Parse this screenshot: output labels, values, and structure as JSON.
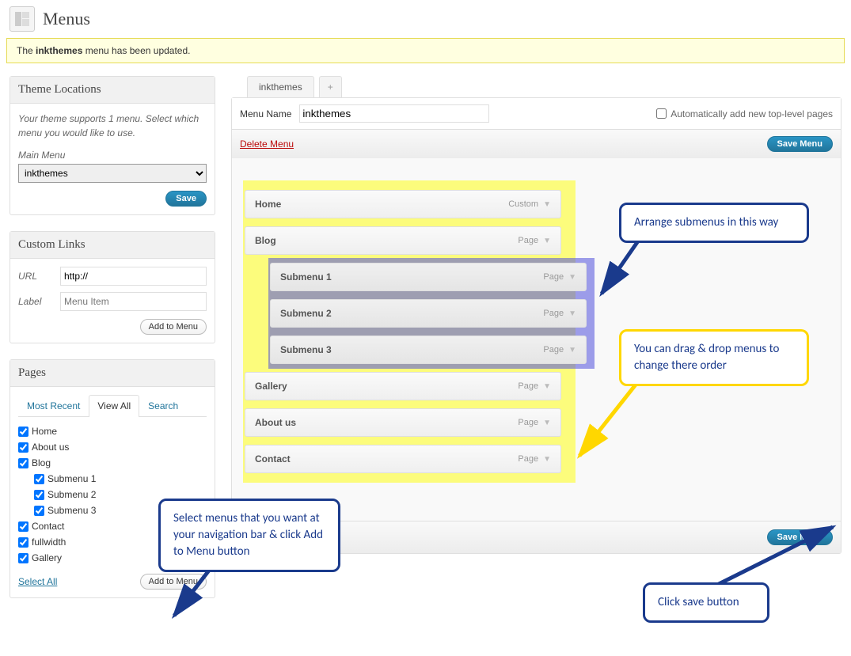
{
  "page": {
    "title": "Menus"
  },
  "notice": {
    "prefix": "The ",
    "bold": "inkthemes",
    "suffix": " menu has been updated."
  },
  "theme_locations": {
    "title": "Theme Locations",
    "desc": "Your theme supports 1 menu. Select which menu you would like to use.",
    "main_label": "Main Menu",
    "selected": "inkthemes",
    "save": "Save"
  },
  "custom_links": {
    "title": "Custom Links",
    "url_label": "URL",
    "url_value": "http://",
    "label_label": "Label",
    "label_placeholder": "Menu Item",
    "add_btn": "Add to Menu"
  },
  "pages": {
    "title": "Pages",
    "tabs": {
      "recent": "Most Recent",
      "all": "View All",
      "search": "Search"
    },
    "items": [
      {
        "label": "Home",
        "indent": false
      },
      {
        "label": "About us",
        "indent": false
      },
      {
        "label": "Blog",
        "indent": false
      },
      {
        "label": "Submenu 1",
        "indent": true
      },
      {
        "label": "Submenu 2",
        "indent": true
      },
      {
        "label": "Submenu 3",
        "indent": true
      },
      {
        "label": "Contact",
        "indent": false
      },
      {
        "label": "fullwidth",
        "indent": false
      },
      {
        "label": "Gallery",
        "indent": false
      }
    ],
    "select_all": "Select All",
    "add_btn": "Add to Menu"
  },
  "menu_editor": {
    "tab": "inkthemes",
    "tab_plus": "+",
    "name_label": "Menu Name",
    "name_value": "inkthemes",
    "auto_add": "Automatically add new top-level pages",
    "delete": "Delete Menu",
    "save": "Save Menu",
    "items": [
      {
        "title": "Home",
        "type": "Custom",
        "sub": false
      },
      {
        "title": "Blog",
        "type": "Page",
        "sub": false
      },
      {
        "title": "Submenu 1",
        "type": "Page",
        "sub": true
      },
      {
        "title": "Submenu 2",
        "type": "Page",
        "sub": true
      },
      {
        "title": "Submenu 3",
        "type": "Page",
        "sub": true
      },
      {
        "title": "Gallery",
        "type": "Page",
        "sub": false
      },
      {
        "title": "About us",
        "type": "Page",
        "sub": false
      },
      {
        "title": "Contact",
        "type": "Page",
        "sub": false
      }
    ]
  },
  "callouts": {
    "c1": "Arrange submenus in this way",
    "c2": "You can drag & drop menus to change there order",
    "c3": "Select menus that you want at your navigation bar & click Add to Menu button",
    "c4": "Click save button"
  }
}
